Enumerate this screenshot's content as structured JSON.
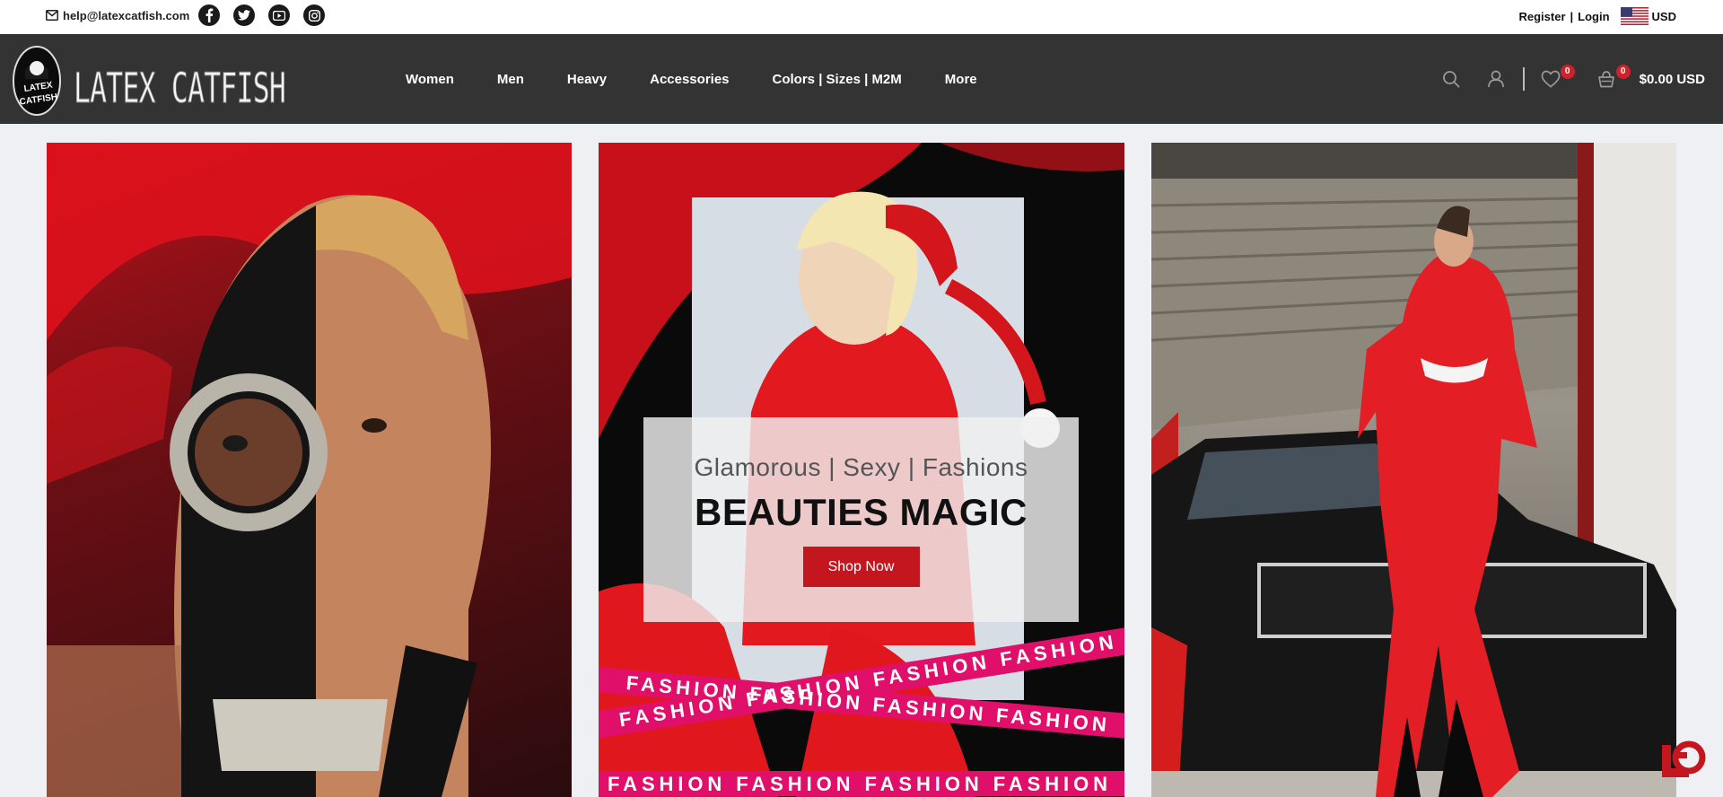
{
  "topbar": {
    "email": "help@latexcatfish.com",
    "social": [
      "facebook-icon",
      "twitter-icon",
      "youtube-icon",
      "instagram-icon"
    ],
    "register_label": "Register",
    "separator": "|",
    "login_label": "Login",
    "currency": "USD"
  },
  "header": {
    "logo_text": "LATEX CATFISH",
    "nav": [
      "Women",
      "Men",
      "Heavy",
      "Accessories",
      "Colors | Sizes | M2M",
      "More"
    ],
    "wishlist_count": "0",
    "cart_count": "0",
    "cart_total": "$0.00 USD"
  },
  "banner": {
    "subtitle": "Glamorous | Sexy | Fashions",
    "title": "BEAUTIES MAGIC",
    "button_label": "Shop Now",
    "ribbon_text": "FASHION FASHION FASHION FASHION"
  },
  "colors": {
    "header_bg": "#333333",
    "accent_red": "#c3161f",
    "badge_red": "#d0202a",
    "page_bg": "#eef0f4"
  }
}
